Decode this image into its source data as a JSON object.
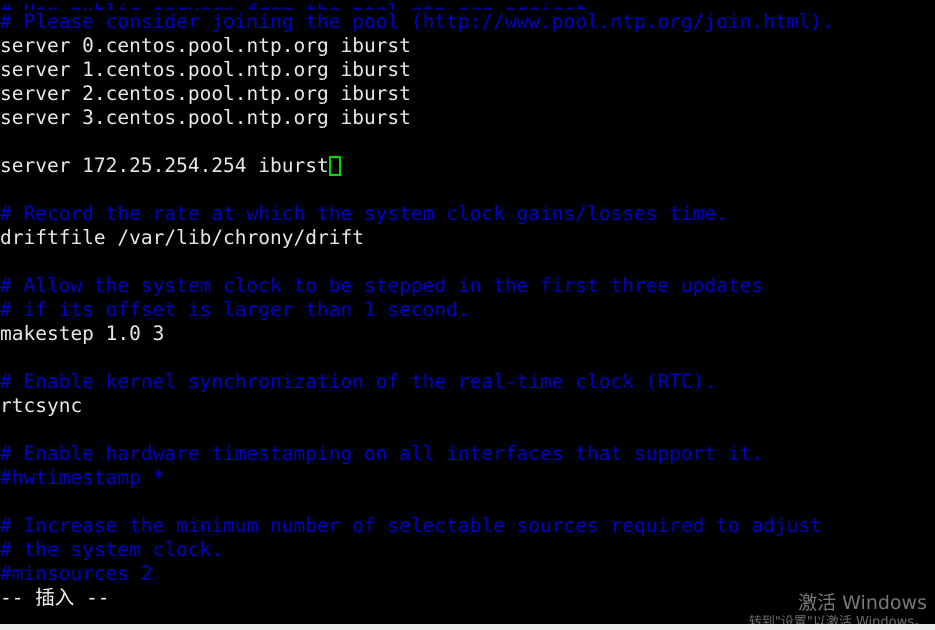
{
  "terminal": {
    "background_color": "#000000",
    "default_text_color": "#e6e6e6",
    "comment_color": "#0000cd",
    "cursor_color": "#00d800",
    "columns": 72,
    "rows": 26,
    "lines": [
      {
        "id": "l01",
        "text": "# Use public servers from the pool.ntp.org project.",
        "style": "comment",
        "clipped": true
      },
      {
        "id": "l02",
        "text": "# Please consider joining the pool (http://www.pool.ntp.org/join.html).",
        "style": "comment"
      },
      {
        "id": "l03",
        "text": "server 0.centos.pool.ntp.org iburst",
        "style": "plain"
      },
      {
        "id": "l04",
        "text": "server 1.centos.pool.ntp.org iburst",
        "style": "plain"
      },
      {
        "id": "l05",
        "text": "server 2.centos.pool.ntp.org iburst",
        "style": "plain"
      },
      {
        "id": "l06",
        "text": "server 3.centos.pool.ntp.org iburst",
        "style": "plain"
      },
      {
        "id": "l07",
        "text": "",
        "style": "plain"
      },
      {
        "id": "l08",
        "text": "server 172.25.254.254 iburst",
        "style": "plain",
        "cursor_after": true
      },
      {
        "id": "l09",
        "text": "",
        "style": "plain"
      },
      {
        "id": "l10",
        "text": "# Record the rate at which the system clock gains/losses time.",
        "style": "comment"
      },
      {
        "id": "l11",
        "text": "driftfile /var/lib/chrony/drift",
        "style": "plain"
      },
      {
        "id": "l12",
        "text": "",
        "style": "plain"
      },
      {
        "id": "l13",
        "text": "# Allow the system clock to be stepped in the first three updates",
        "style": "comment"
      },
      {
        "id": "l14",
        "text": "# if its offset is larger than 1 second.",
        "style": "comment"
      },
      {
        "id": "l15",
        "text": "makestep 1.0 3",
        "style": "plain"
      },
      {
        "id": "l16",
        "text": "",
        "style": "plain"
      },
      {
        "id": "l17",
        "text": "# Enable kernel synchronization of the real-time clock (RTC).",
        "style": "comment"
      },
      {
        "id": "l18",
        "text": "rtcsync",
        "style": "plain"
      },
      {
        "id": "l19",
        "text": "",
        "style": "plain"
      },
      {
        "id": "l20",
        "text": "# Enable hardware timestamping on all interfaces that support it.",
        "style": "comment"
      },
      {
        "id": "l21",
        "text": "#hwtimestamp *",
        "style": "comment"
      },
      {
        "id": "l22",
        "text": "",
        "style": "plain"
      },
      {
        "id": "l23",
        "text": "# Increase the minimum number of selectable sources required to adjust",
        "style": "comment"
      },
      {
        "id": "l24",
        "text": "# the system clock.",
        "style": "comment"
      },
      {
        "id": "l25",
        "text": "#minsources 2",
        "style": "comment"
      }
    ],
    "status_line": "-- 插入 --",
    "cursor": {
      "shape": "hollow-block",
      "line_id": "l08",
      "column": 28
    }
  },
  "watermark": {
    "title": "激活 Windows",
    "subtitle": "转到\"设置\"以激活 Windows。"
  }
}
